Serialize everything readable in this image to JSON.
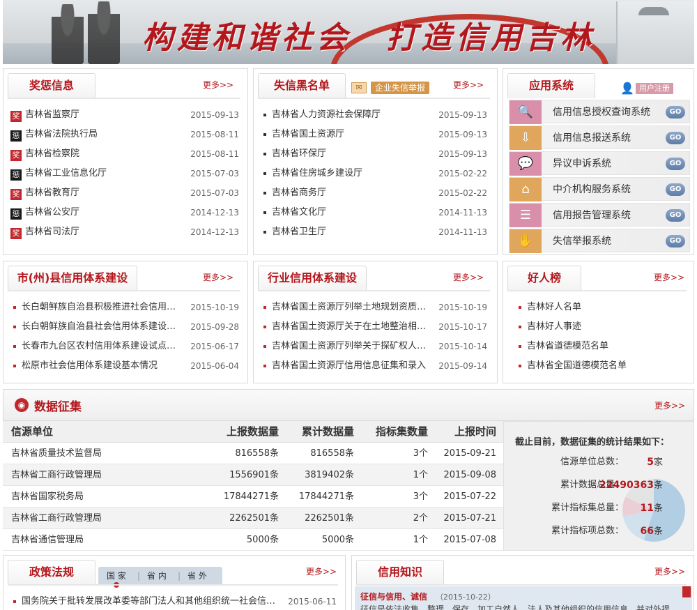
{
  "banner": {
    "slogan": "构建和谐社会　打造信用吉林"
  },
  "more_label": "更多>>",
  "reward": {
    "title": "奖惩信息",
    "items": [
      {
        "badge": "奖",
        "kind": "reward",
        "name": "吉林省监察厅",
        "date": "2015-09-13"
      },
      {
        "badge": "惩",
        "kind": "punish",
        "name": "吉林省法院执行局",
        "date": "2015-08-11"
      },
      {
        "badge": "奖",
        "kind": "reward",
        "name": "吉林省检察院",
        "date": "2015-08-11"
      },
      {
        "badge": "惩",
        "kind": "punish",
        "name": "吉林省工业信息化厅",
        "date": "2015-07-03"
      },
      {
        "badge": "奖",
        "kind": "reward",
        "name": "吉林省教育厅",
        "date": "2015-07-03"
      },
      {
        "badge": "惩",
        "kind": "punish",
        "name": "吉林省公安厅",
        "date": "2014-12-13"
      },
      {
        "badge": "奖",
        "kind": "reward",
        "name": "吉林省司法厅",
        "date": "2014-12-13"
      }
    ]
  },
  "blacklist": {
    "title": "失信黑名单",
    "report_label": "企业失信举报",
    "items": [
      {
        "name": "吉林省人力资源社会保障厅",
        "date": "2015-09-13"
      },
      {
        "name": "吉林省国土资源厅",
        "date": "2015-09-13"
      },
      {
        "name": "吉林省环保厅",
        "date": "2015-09-13"
      },
      {
        "name": "吉林省住房城乡建设厅",
        "date": "2015-02-22"
      },
      {
        "name": "吉林省商务厅",
        "date": "2015-02-22"
      },
      {
        "name": "吉林省文化厅",
        "date": "2014-11-13"
      },
      {
        "name": "吉林省卫生厅",
        "date": "2014-11-13"
      }
    ]
  },
  "apps": {
    "title": "应用系统",
    "register_label": "用户注册",
    "go_label": "GO",
    "items": [
      {
        "label": "信用信息授权查询系统",
        "icon": "search-icon",
        "glyph": "🔍",
        "color": "#d98fa9"
      },
      {
        "label": "信用信息报送系统",
        "icon": "upload-screen-icon",
        "glyph": "⇩",
        "color": "#e0a65c"
      },
      {
        "label": "异议申诉系统",
        "icon": "chat-bubble-icon",
        "glyph": "💬",
        "color": "#d98fa9"
      },
      {
        "label": "中介机构服务系统",
        "icon": "home-icon",
        "glyph": "⌂",
        "color": "#e0a65c"
      },
      {
        "label": "信用报告管理系统",
        "icon": "report-icon",
        "glyph": "☰",
        "color": "#d98fa9"
      },
      {
        "label": "失信举报系统",
        "icon": "hand-icon",
        "glyph": "✋",
        "color": "#e0a65c"
      }
    ]
  },
  "city": {
    "title": "市(州)县信用体系建设",
    "items": [
      {
        "name": "长白朝鲜族自治县积极推进社会信用体系建设",
        "date": "2015-10-19"
      },
      {
        "name": "长白朝鲜族自治县社会信用体系建设工作",
        "date": "2015-09-28"
      },
      {
        "name": "长春市九台区农村信用体系建设试点工作",
        "date": "2015-06-17"
      },
      {
        "name": "松原市社会信用体系建设基本情况",
        "date": "2015-06-04"
      }
    ]
  },
  "industry": {
    "title": "行业信用体系建设",
    "items": [
      {
        "name": "吉林省国土资源厅列举土地规划资质单位信用",
        "date": "2015-10-19"
      },
      {
        "name": "吉林省国土资源厅关于在土地整治相关领域",
        "date": "2015-10-17"
      },
      {
        "name": "吉林省国土资源厅列举关于探矿权人信用",
        "date": "2015-10-14"
      },
      {
        "name": "吉林省国土资源厅信用信息征集和录入",
        "date": "2015-09-14"
      }
    ]
  },
  "good": {
    "title": "好人榜",
    "items": [
      "吉林好人名单",
      "吉林好人事迹",
      "吉林省道德模范名单",
      "吉林省全国道德模范名单"
    ]
  },
  "data_collection": {
    "title": "数据征集",
    "columns": [
      "信源单位",
      "上报数据量",
      "累计数据量",
      "指标集数量",
      "上报时间"
    ],
    "rows": [
      [
        "吉林省质量技术监督局",
        "816558条",
        "816558条",
        "3个",
        "2015-09-21"
      ],
      [
        "吉林省工商行政管理局",
        "1556901条",
        "3819402条",
        "1个",
        "2015-09-08"
      ],
      [
        "吉林省国家税务局",
        "17844271条",
        "17844271条",
        "3个",
        "2015-07-22"
      ],
      [
        "吉林省工商行政管理局",
        "2262501条",
        "2262501条",
        "2个",
        "2015-07-21"
      ],
      [
        "吉林省通信管理局",
        "5000条",
        "5000条",
        "1个",
        "2015-07-08"
      ]
    ],
    "summary_title": "截止目前，数据征集的统计结果如下：",
    "stats": [
      {
        "label": "信源单位总数：",
        "value": "5",
        "unit": "家"
      },
      {
        "label": "累计数据总量：",
        "value": "22490363",
        "unit": "条"
      },
      {
        "label": "累计指标集总量：",
        "value": "11",
        "unit": "条"
      },
      {
        "label": "累计指标项总数：",
        "value": "66",
        "unit": "条"
      }
    ]
  },
  "policy": {
    "title": "政策法规",
    "subtabs": [
      "国 家",
      "省 内",
      "省 外"
    ],
    "items": [
      {
        "name": "国务院关于批转发展改革委等部门法人和其他组织统一社会信用代码",
        "date": "2015-06-11"
      }
    ]
  },
  "knowledge": {
    "title": "信用知识",
    "headline": "征信与信用、诚信",
    "date": "（2015-10-22）",
    "snippet": "征信是依法收集、整理、保存、加工自然人、法人及其他组织的信用信息，并对外提"
  }
}
